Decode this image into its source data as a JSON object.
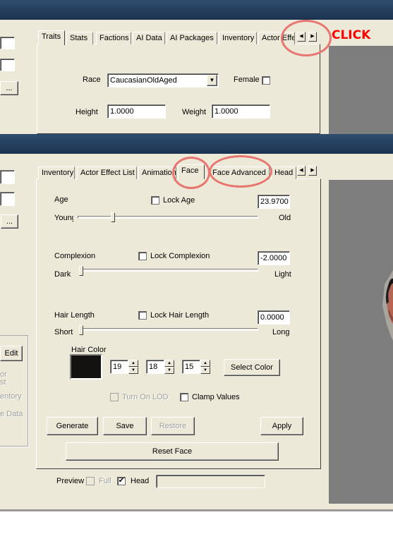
{
  "window1": {
    "tabs": [
      "Traits",
      "Stats",
      "Factions",
      "AI Data",
      "AI Packages",
      "Inventory",
      "Actor Effe"
    ],
    "race_label": "Race",
    "race_value": "CaucasianOldAged",
    "female_label": "Female",
    "height_label": "Height",
    "height_value": "1.0000",
    "weight_label": "Weight",
    "weight_value": "1.0000",
    "left_button": "..."
  },
  "callout": {
    "text": "CLICK",
    "color": "#ff0000"
  },
  "window2": {
    "tabs": [
      "Inventory",
      "Actor Effect List",
      "Animation",
      "Face",
      "Face Advanced",
      "Head I"
    ],
    "left_button": "...",
    "edit_button": "Edit",
    "left_labels": [
      "or",
      "st",
      "entory",
      "e Data"
    ],
    "age": {
      "label": "Age",
      "lock_label": "Lock Age",
      "value": "23.9700",
      "min_label": "Young",
      "max_label": "Old",
      "slider_fraction": 0.18
    },
    "complexion": {
      "label": "Complexion",
      "lock_label": "Lock Complexion",
      "value": "-2.0000",
      "min_label": "Dark",
      "max_label": "Light",
      "slider_fraction": 0.0
    },
    "hair_length": {
      "label": "Hair Length",
      "lock_label": "Lock Hair Length",
      "value": "0.0000",
      "min_label": "Short",
      "max_label": "Long",
      "slider_fraction": 0.0
    },
    "hair_color": {
      "label": "Hair Color",
      "swatch": "#131210",
      "r": "19",
      "g": "18",
      "b": "15",
      "select_button": "Select Color"
    },
    "turn_on_lod_label": "Turn On LOD",
    "clamp_values_label": "Clamp Values",
    "buttons": {
      "generate": "Generate",
      "save": "Save",
      "restore": "Restore",
      "apply": "Apply",
      "reset_face": "Reset Face"
    },
    "preview": {
      "label": "Preview",
      "full_label": "Full",
      "head_label": "Head",
      "head_checked": "✔"
    }
  },
  "colors": {
    "titlebar": "#1b3350",
    "panel": "#ece9d8",
    "highlight_ring": "#e8756f"
  }
}
